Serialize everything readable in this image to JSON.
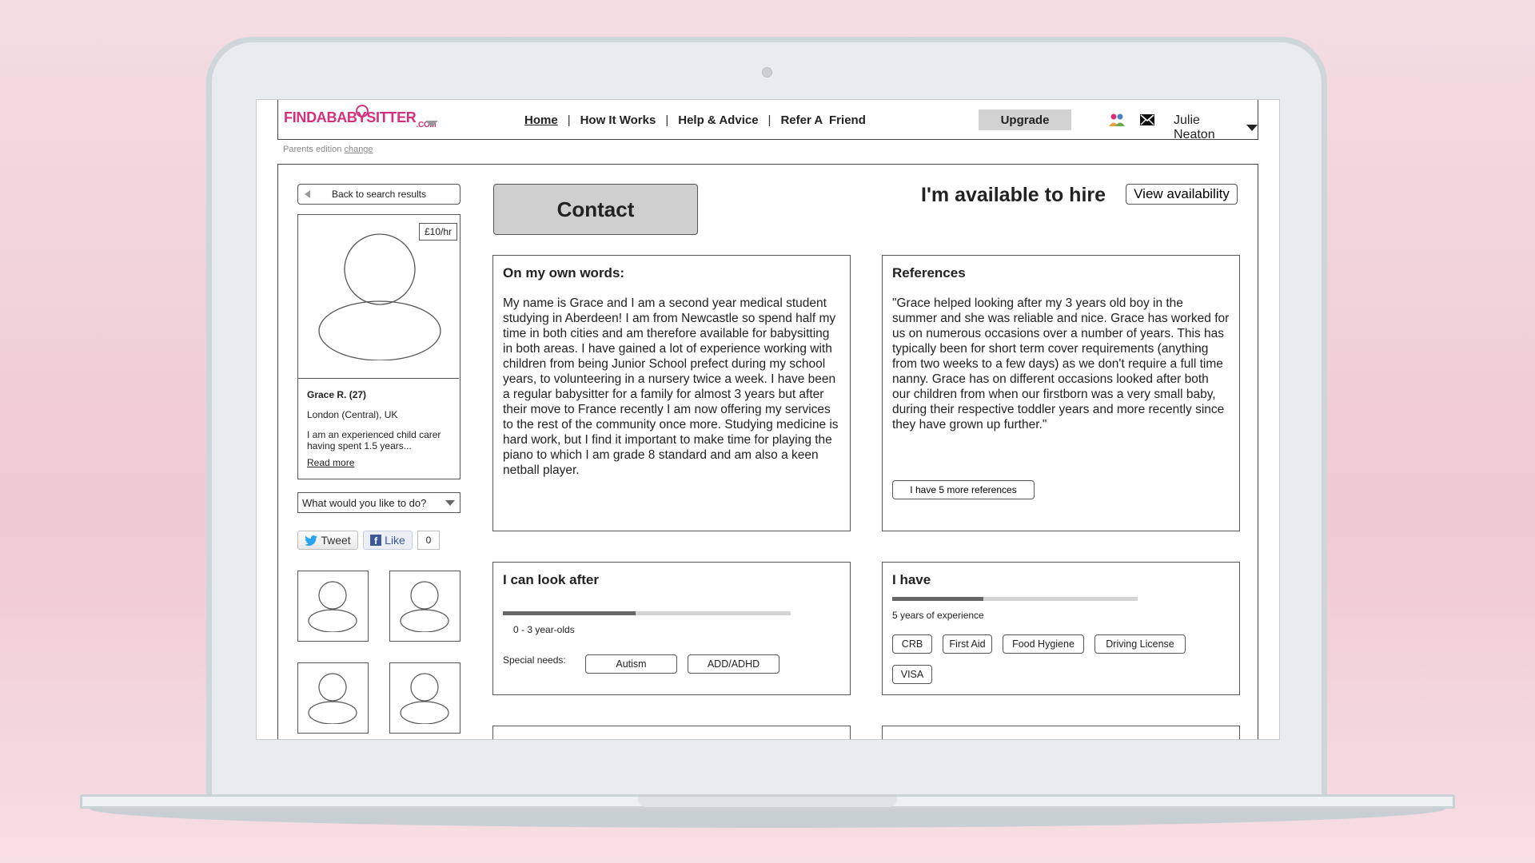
{
  "header": {
    "logo": {
      "text": "FINDABABYSITTER",
      "suffix": ".COM"
    },
    "nav": [
      "Home",
      "How It Works",
      "Help & Advice",
      "Refer A  Friend"
    ],
    "upgrade_label": "Upgrade",
    "user_name": "Julie Neaton",
    "edition_text": "Parents edition",
    "edition_change": "change"
  },
  "sidebar": {
    "back_label": "Back to search results",
    "rate": "£10/hr",
    "name": "Grace R. (27)",
    "location": "London (Central), UK",
    "bio": "I am an experienced child carer having spent 1.5 years...",
    "read_more": "Read more",
    "action_placeholder": "What would you like to do?",
    "tweet_label": "Tweet",
    "like_label": "Like",
    "like_count": "0"
  },
  "main": {
    "contact_label": "Contact",
    "available_text": "I'm available to hire",
    "view_availability_label": "View availability",
    "own_words": {
      "title": "On my own words:",
      "text": "My name is Grace and I am a second year medical student studying in Aberdeen! I am from Newcastle so spend half my time in both cities and am therefore available for babysitting in both areas. I have gained a lot of experience working with children from being Junior School prefect during my school years, to volunteering in a nursery twice a week. I have been a regular babysitter for a family for almost 3 years but after their move to France recently I am now offering my services to the rest of the community once more. Studying medicine is hard work, but I find it important to make time for playing the piano to which I am grade 8 standard and am also a keen netball player."
    },
    "references": {
      "title": "References",
      "text": "\"Grace helped looking after my 3 years old boy in the summer and she was reliable and nice. Grace has worked for us on numerous occasions over a number of years. This has typically been for short term cover requirements (anything from two weeks to a few days) as we don't require a full time nanny. Grace has on different occasions looked after both our children from when our firstborn was a very small baby, during their respective toddler years and more recently since they have grown up further.\"",
      "more_label": "I have 5 more references"
    },
    "look_after": {
      "title": "I can look after",
      "age_label": "0 - 3 year-olds",
      "age_fraction": 0.46,
      "special_needs_label": "Special needs:",
      "special_needs": [
        "Autism",
        "ADD/ADHD"
      ]
    },
    "i_have": {
      "title": "I have",
      "experience_label": "5 years of experience",
      "experience_fraction": 0.37,
      "qualifications": [
        "CRB",
        "First Aid",
        "Food Hygiene",
        "Driving License",
        "VISA"
      ]
    }
  },
  "colors": {
    "brand": "#d6307a",
    "accent_bar": "#666666",
    "button_gray": "#cfcfcf"
  }
}
